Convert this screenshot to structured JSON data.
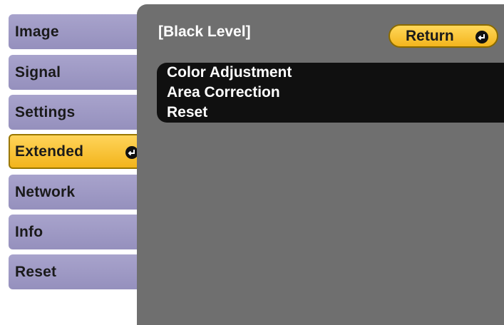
{
  "menu": {
    "items": [
      {
        "label": "Image",
        "selected": false
      },
      {
        "label": "Signal",
        "selected": false
      },
      {
        "label": "Settings",
        "selected": false
      },
      {
        "label": "Extended",
        "selected": true
      },
      {
        "label": "Network",
        "selected": false
      },
      {
        "label": "Info",
        "selected": false
      },
      {
        "label": "Reset",
        "selected": false
      }
    ]
  },
  "panel": {
    "title": "[Black Level]",
    "return_label": "Return",
    "options": [
      {
        "label": "Color Adjustment"
      },
      {
        "label": "Area Correction"
      },
      {
        "label": "Reset"
      }
    ]
  },
  "icons": {
    "enter": "enter-icon"
  },
  "colors": {
    "menu_item": "#9f9ac6",
    "selected": "#f5bb24",
    "panel": "#6f6f6f",
    "option": "#101010"
  }
}
